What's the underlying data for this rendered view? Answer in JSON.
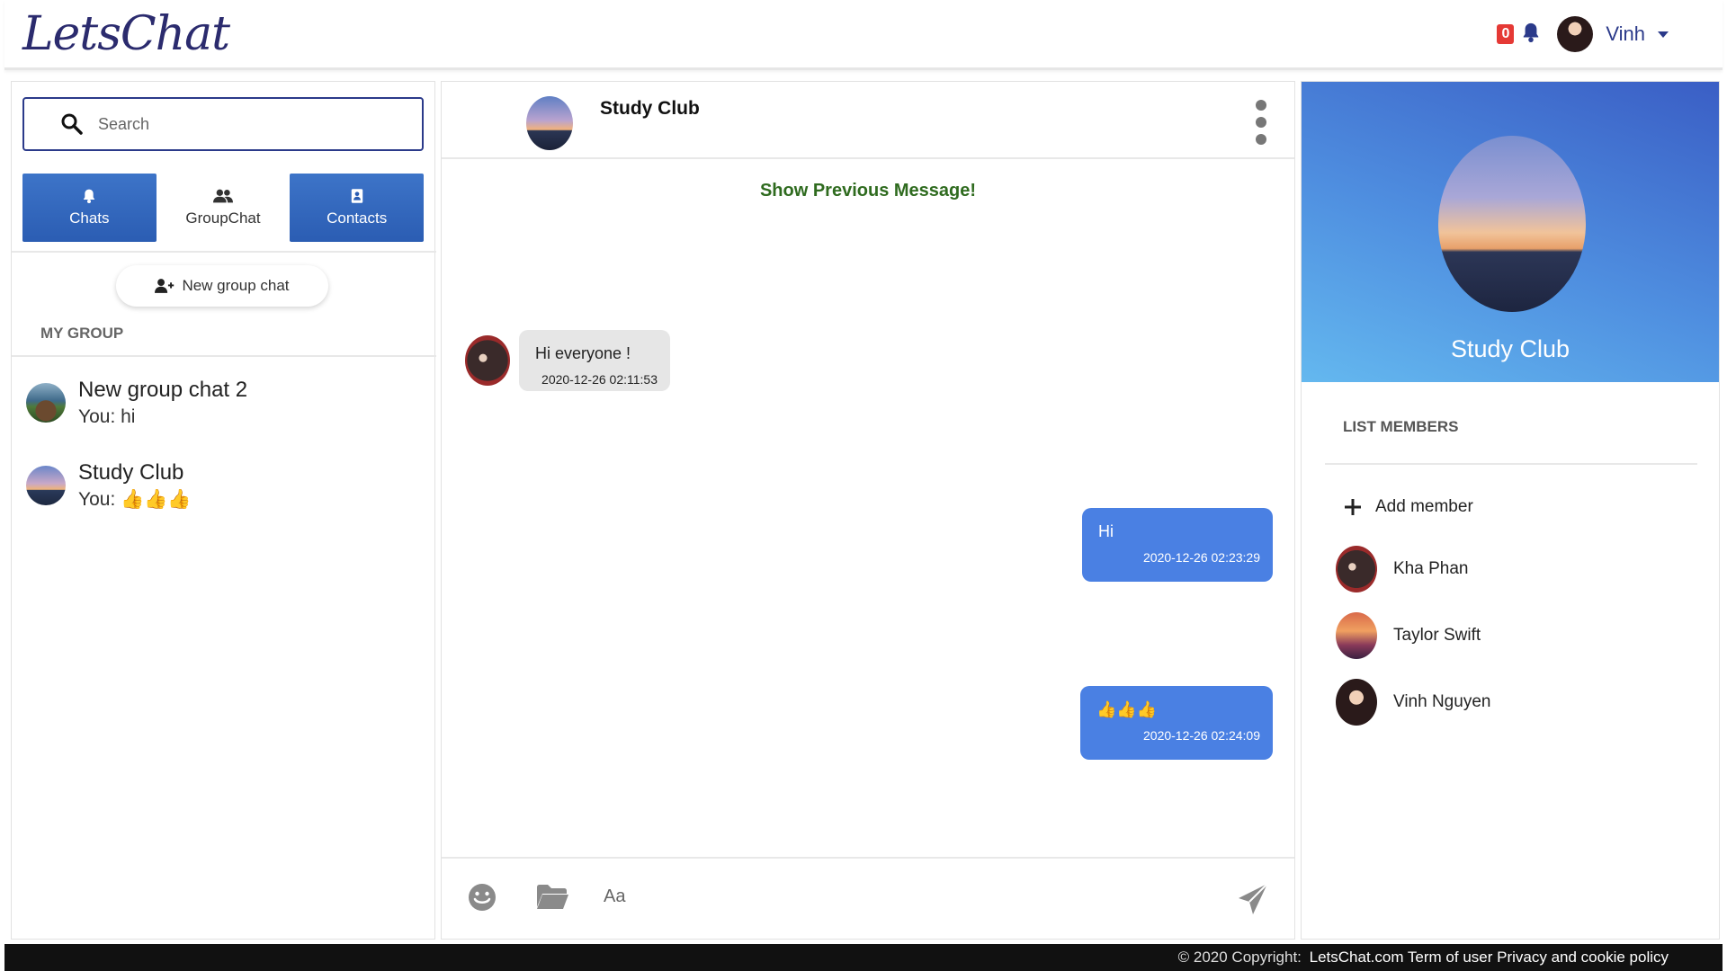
{
  "header": {
    "logo": "LetsChat",
    "notification_count": "0",
    "user_name": "Vinh"
  },
  "sidebar": {
    "search_placeholder": "Search",
    "tabs": [
      {
        "label": "Chats",
        "icon": "bell-icon",
        "active": true
      },
      {
        "label": "GroupChat",
        "icon": "users-icon",
        "active": false
      },
      {
        "label": "Contacts",
        "icon": "contact-book-icon",
        "active": true
      }
    ],
    "new_group_label": "New group chat",
    "my_group_title": "MY GROUP",
    "groups": [
      {
        "name": "New group chat 2",
        "last_message": "You: hi"
      },
      {
        "name": "Study Club",
        "last_message": "You: 👍👍👍"
      }
    ]
  },
  "chat": {
    "title": "Study Club",
    "show_previous": "Show Previous Message!",
    "messages": [
      {
        "direction": "in",
        "text": "Hi everyone !",
        "time": "2020-12-26 02:11:53"
      },
      {
        "direction": "out",
        "text": "Hi",
        "time": "2020-12-26 02:23:29"
      },
      {
        "direction": "out",
        "text": "👍👍👍",
        "time": "2020-12-26 02:24:09"
      }
    ],
    "input_placeholder": "Aa"
  },
  "info": {
    "group_name": "Study Club",
    "list_title": "LIST MEMBERS",
    "add_member_label": "Add member",
    "members": [
      {
        "name": "Kha Phan"
      },
      {
        "name": "Taylor Swift"
      },
      {
        "name": "Vinh Nguyen"
      }
    ]
  },
  "footer": {
    "copyright": "© 2020 Copyright:",
    "links": "LetsChat.com Term of user Privacy and cookie policy"
  },
  "colors": {
    "accent": "#4a80e3",
    "brand": "#2b3a8a",
    "show_previous": "#2f6b1f",
    "badge": "#e53935"
  }
}
